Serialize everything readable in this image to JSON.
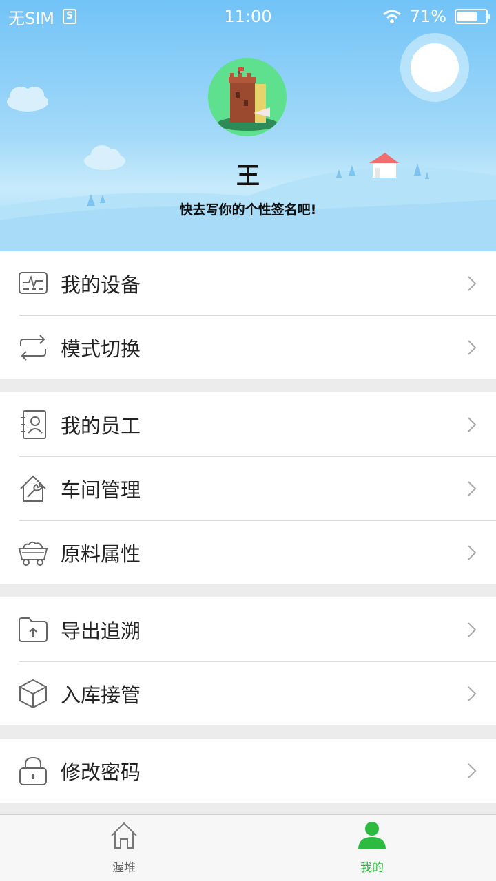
{
  "status_bar": {
    "carrier": "无SIM",
    "time": "11:00",
    "battery_text": "71%",
    "battery_level": 0.71
  },
  "profile": {
    "name": "王",
    "signature": "快去写你的个性签名吧!"
  },
  "menu_groups": [
    [
      {
        "label": "我的设备",
        "icon": "device-monitor-icon"
      },
      {
        "label": "模式切换",
        "icon": "switch-arrows-icon"
      }
    ],
    [
      {
        "label": "我的员工",
        "icon": "employee-contact-icon"
      },
      {
        "label": "车间管理",
        "icon": "workshop-wrench-icon"
      },
      {
        "label": "原料属性",
        "icon": "mine-cart-icon"
      }
    ],
    [
      {
        "label": "导出追溯",
        "icon": "folder-upload-icon"
      },
      {
        "label": "入库接管",
        "icon": "package-box-icon"
      }
    ],
    [
      {
        "label": "修改密码",
        "icon": "lock-icon"
      }
    ]
  ],
  "tabs": [
    {
      "label": "渥堆",
      "icon": "home-icon",
      "active": false
    },
    {
      "label": "我的",
      "icon": "user-icon",
      "active": true
    }
  ],
  "colors": {
    "accent": "#2dba41",
    "sky": "#72c3f7"
  }
}
